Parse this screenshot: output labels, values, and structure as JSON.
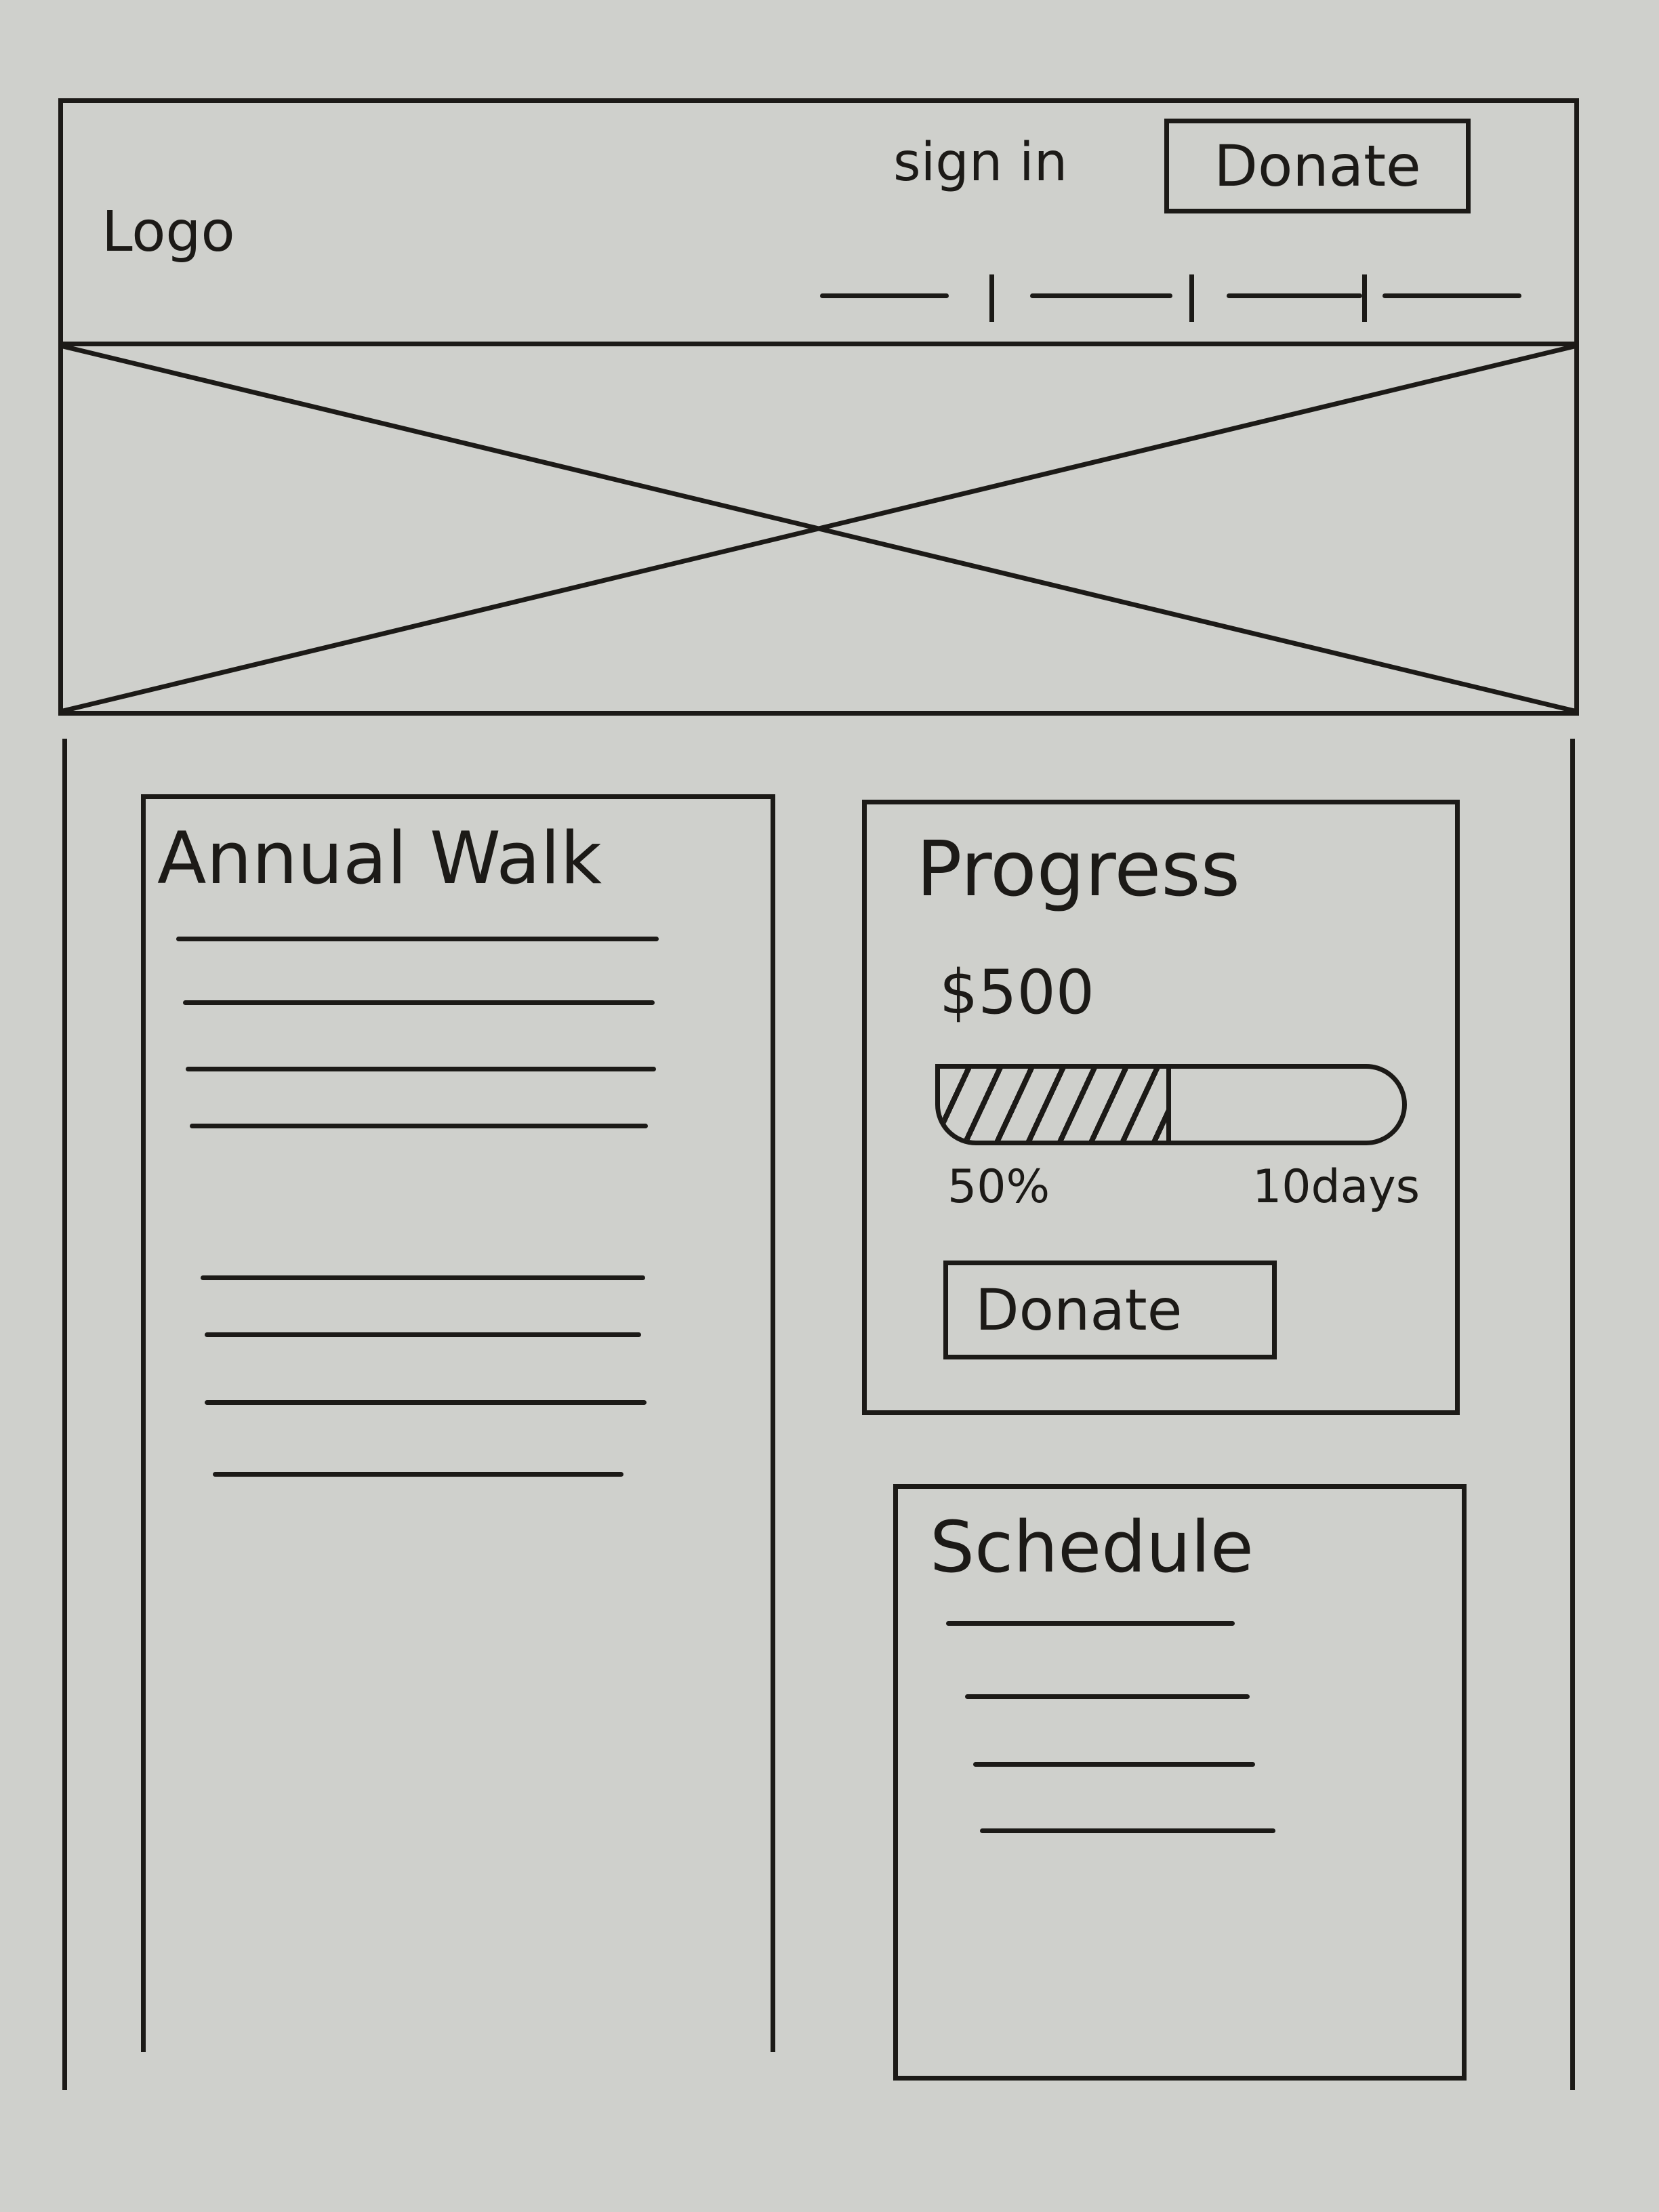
{
  "header": {
    "logo_text": "Logo",
    "signin_label": "sign in",
    "donate_label": "Donate",
    "nav_items": 4
  },
  "hero": {
    "type": "image-placeholder"
  },
  "annual_walk": {
    "title": "Annual Walk",
    "paragraph_lines": 8
  },
  "progress": {
    "title": "Progress",
    "amount": "$500",
    "percent_label": "50%",
    "percent_value": 0.5,
    "days_label": "10days",
    "donate_label": "Donate"
  },
  "schedule": {
    "title": "Schedule",
    "item_lines": 4
  }
}
